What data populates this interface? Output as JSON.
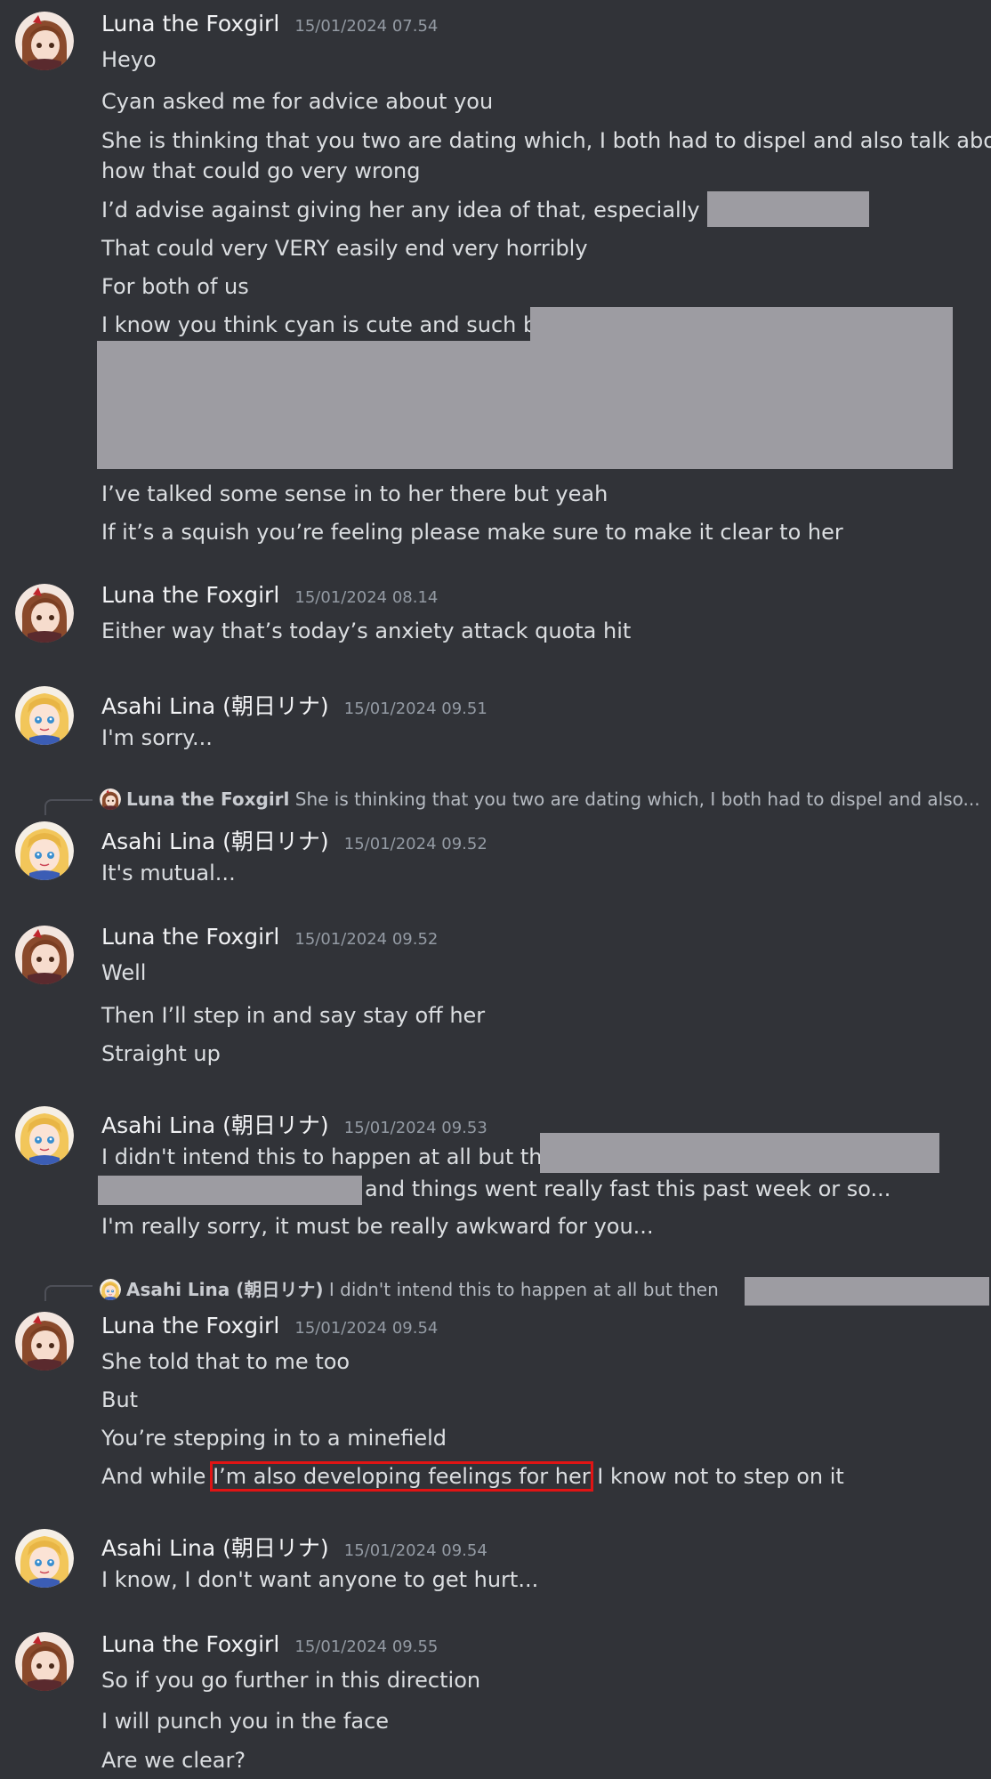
{
  "messages": [
    {
      "author": "Luna the Foxgirl",
      "timestamp": "15/01/2024 07.54",
      "lines": [
        "Heyo",
        "Cyan asked me for advice about you",
        "She is thinking that you two are dating which, I both had to dispel and also talk about",
        "how that could go very wrong",
        "I’d advise against giving her any idea of that, especially when",
        "That could very VERY easily end very horribly",
        "For both of us",
        "I know you think cyan is cute and such but,",
        "I’ve talked some sense in to her there but yeah",
        "If it’s a squish you’re feeling please make sure to make it clear to her"
      ]
    },
    {
      "author": "Luna the Foxgirl",
      "timestamp": "15/01/2024 08.14",
      "lines": [
        "Either way that’s today’s anxiety attack quota hit"
      ]
    },
    {
      "author": "Asahi Lina (朝日リナ)",
      "timestamp": "15/01/2024 09.51",
      "lines": [
        "I'm sorry..."
      ]
    },
    {
      "reply": {
        "author": "Luna the Foxgirl",
        "text": "She is thinking that you two are dating which, I both had to dispel and also..."
      },
      "author": "Asahi Lina (朝日リナ)",
      "timestamp": "15/01/2024 09.52",
      "lines": [
        "It's mutual..."
      ]
    },
    {
      "author": "Luna the Foxgirl",
      "timestamp": "15/01/2024 09.52",
      "lines": [
        "Well",
        "Then I’ll step in and say stay off her",
        "Straight up"
      ]
    },
    {
      "author": "Asahi Lina (朝日リナ)",
      "timestamp": "15/01/2024 09.53",
      "lines": [
        "I didn't intend this to happen at all but then",
        "and things went really fast this past week or so...",
        "I'm really sorry, it must be really awkward for you..."
      ]
    },
    {
      "reply": {
        "author": "Asahi Lina (朝日リナ)",
        "text": "I didn't intend this to happen at all but then"
      },
      "author": "Luna the Foxgirl",
      "timestamp": "15/01/2024 09.54",
      "lines": [
        "She told that to me too",
        "But",
        "You’re stepping in to a minefield",
        "And while ",
        "I’m also developing feelings for her",
        " I know not to step on it"
      ]
    },
    {
      "author": "Asahi Lina (朝日リナ)",
      "timestamp": "15/01/2024 09.54",
      "lines": [
        "I know, I don't want anyone to get hurt..."
      ]
    },
    {
      "author": "Luna the Foxgirl",
      "timestamp": "15/01/2024 09.55",
      "lines": [
        "So if you go further in this direction",
        "I will punch you in the face",
        "Are we clear?"
      ]
    }
  ],
  "colors": {
    "background": "#313338",
    "redaction": "#9d9ca2",
    "highlight": "#e01414"
  }
}
